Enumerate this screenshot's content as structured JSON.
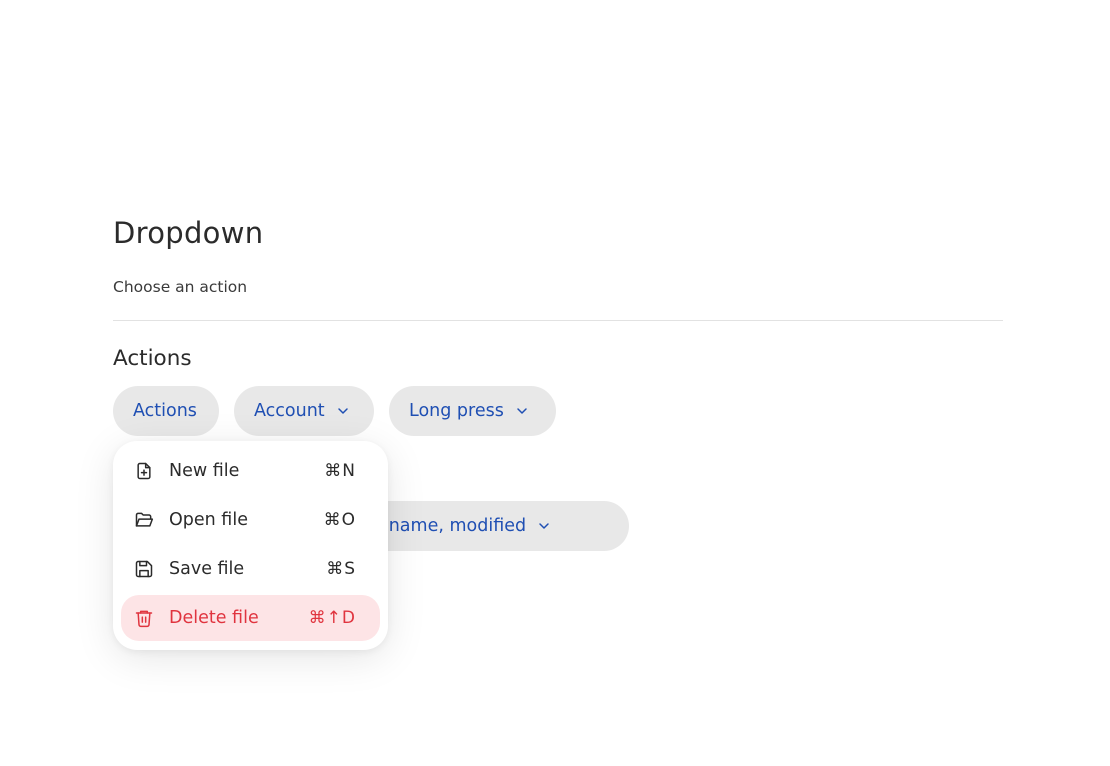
{
  "page": {
    "title": "Dropdown",
    "subtitle": "Choose an action"
  },
  "section": {
    "title": "Actions"
  },
  "buttons": {
    "actions": "Actions",
    "account": "Account",
    "long_press": "Long press",
    "columns": "mns: name, modified"
  },
  "menu": {
    "items": [
      {
        "label": "New file",
        "shortcut": "⌘N",
        "icon": "file-plus-icon"
      },
      {
        "label": "Open file",
        "shortcut": "⌘O",
        "icon": "folder-open-icon"
      },
      {
        "label": "Save file",
        "shortcut": "⌘S",
        "icon": "save-icon"
      },
      {
        "label": "Delete file",
        "shortcut": "⌘↑D",
        "icon": "trash-icon"
      }
    ]
  },
  "colors": {
    "accent_text": "#1f4fb3",
    "pill_bg": "#e8e8e8",
    "danger_text": "#e0343f",
    "danger_bg": "#fde4e6"
  }
}
